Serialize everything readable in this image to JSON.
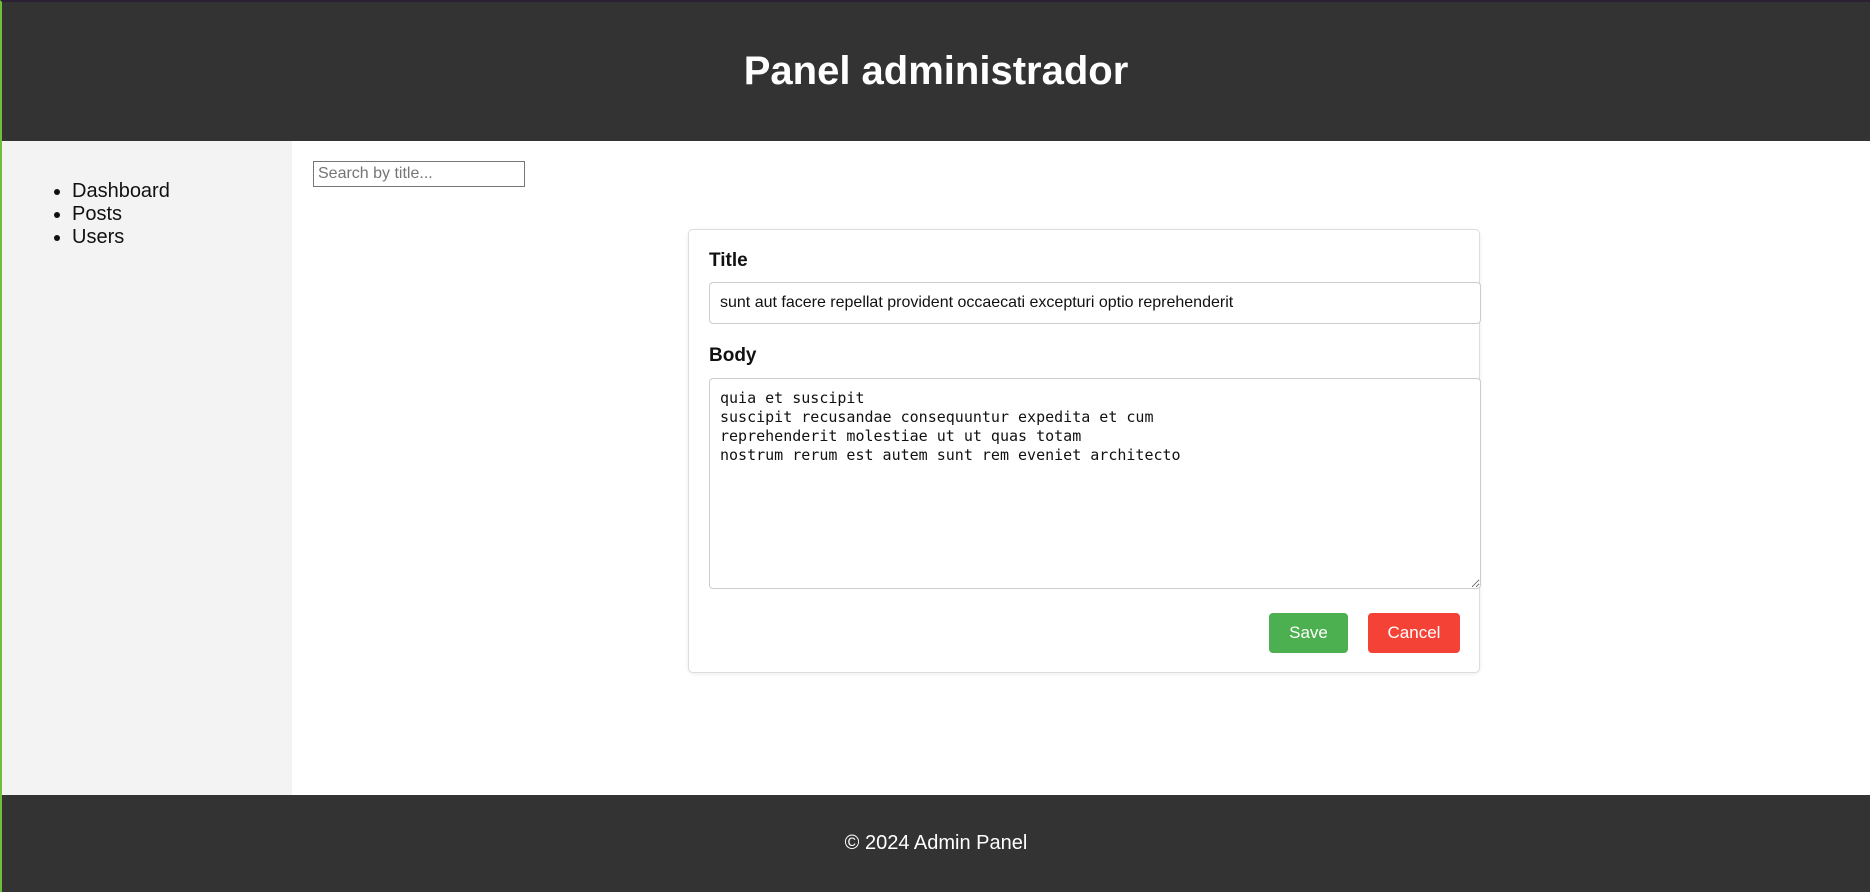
{
  "header": {
    "title": "Panel administrador"
  },
  "sidebar": {
    "items": [
      {
        "label": "Dashboard"
      },
      {
        "label": "Posts"
      },
      {
        "label": "Users"
      }
    ]
  },
  "search": {
    "placeholder": "Search by title...",
    "value": ""
  },
  "form": {
    "title_label": "Title",
    "title_value": "sunt aut facere repellat provident occaecati excepturi optio reprehenderit",
    "body_label": "Body",
    "body_value": "quia et suscipit\nsuscipit recusandae consequuntur expedita et cum\nreprehenderit molestiae ut ut quas totam\nnostrum rerum est autem sunt rem eveniet architecto",
    "save_label": "Save",
    "cancel_label": "Cancel"
  },
  "footer": {
    "text": "© 2024 Admin Panel"
  },
  "colors": {
    "header_bg": "#333333",
    "sidebar_bg": "#f3f3f3",
    "save": "#4caf50",
    "cancel": "#f44336"
  }
}
